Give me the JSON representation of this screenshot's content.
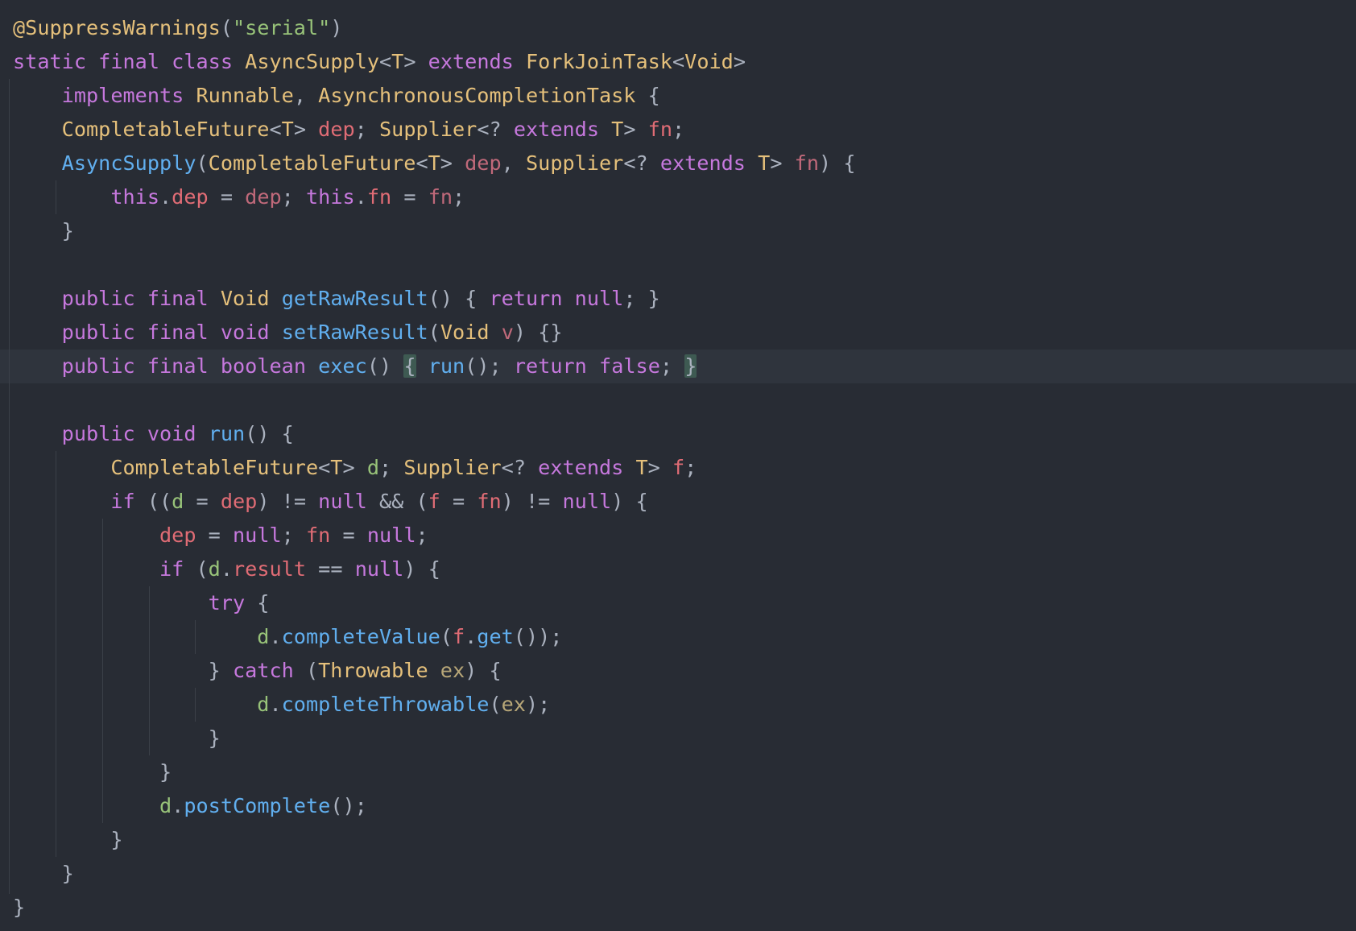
{
  "editor": {
    "theme": {
      "background": "#282c34",
      "current_line": "#2f343d",
      "indent_guide": "#3b4048",
      "brace_match": "#3e5a52",
      "colors": {
        "kw": "#c678dd",
        "type": "#e5c07b",
        "fn": "#61afef",
        "field": "#e06c75",
        "param": "#c0697a",
        "local": "#98c379",
        "catch": "#b8a778",
        "str": "#98c379",
        "ann": "#e5c07b",
        "p": "#abb2bf"
      }
    },
    "current_line_index": 10,
    "lines": [
      {
        "tokens": [
          [
            "ann",
            "@SuppressWarnings"
          ],
          [
            "p",
            "("
          ],
          [
            "str",
            "\"serial\""
          ],
          [
            "p",
            ")"
          ]
        ]
      },
      {
        "tokens": [
          [
            "kw",
            "static"
          ],
          [
            "p",
            " "
          ],
          [
            "kw",
            "final"
          ],
          [
            "p",
            " "
          ],
          [
            "kw",
            "class"
          ],
          [
            "p",
            " "
          ],
          [
            "type",
            "AsyncSupply"
          ],
          [
            "p",
            "<"
          ],
          [
            "type",
            "T"
          ],
          [
            "p",
            "> "
          ],
          [
            "kw",
            "extends"
          ],
          [
            "p",
            " "
          ],
          [
            "type",
            "ForkJoinTask"
          ],
          [
            "p",
            "<"
          ],
          [
            "type",
            "Void"
          ],
          [
            "p",
            ">"
          ]
        ]
      },
      {
        "tokens": [
          [
            "p",
            "    "
          ],
          [
            "kw",
            "implements"
          ],
          [
            "p",
            " "
          ],
          [
            "type",
            "Runnable"
          ],
          [
            "p",
            ", "
          ],
          [
            "type",
            "AsynchronousCompletionTask"
          ],
          [
            "p",
            " {"
          ]
        ]
      },
      {
        "tokens": [
          [
            "p",
            "    "
          ],
          [
            "type",
            "CompletableFuture"
          ],
          [
            "p",
            "<"
          ],
          [
            "type",
            "T"
          ],
          [
            "p",
            "> "
          ],
          [
            "field",
            "dep"
          ],
          [
            "p",
            "; "
          ],
          [
            "type",
            "Supplier"
          ],
          [
            "p",
            "<? "
          ],
          [
            "kw",
            "extends"
          ],
          [
            "p",
            " "
          ],
          [
            "type",
            "T"
          ],
          [
            "p",
            "> "
          ],
          [
            "field",
            "fn"
          ],
          [
            "p",
            ";"
          ]
        ]
      },
      {
        "tokens": [
          [
            "p",
            "    "
          ],
          [
            "fn",
            "AsyncSupply"
          ],
          [
            "p",
            "("
          ],
          [
            "type",
            "CompletableFuture"
          ],
          [
            "p",
            "<"
          ],
          [
            "type",
            "T"
          ],
          [
            "p",
            "> "
          ],
          [
            "param",
            "dep"
          ],
          [
            "p",
            ", "
          ],
          [
            "type",
            "Supplier"
          ],
          [
            "p",
            "<? "
          ],
          [
            "kw",
            "extends"
          ],
          [
            "p",
            " "
          ],
          [
            "type",
            "T"
          ],
          [
            "p",
            "> "
          ],
          [
            "param",
            "fn"
          ],
          [
            "p",
            ") {"
          ]
        ]
      },
      {
        "tokens": [
          [
            "p",
            "        "
          ],
          [
            "kw",
            "this"
          ],
          [
            "p",
            "."
          ],
          [
            "field",
            "dep"
          ],
          [
            "p",
            " = "
          ],
          [
            "param",
            "dep"
          ],
          [
            "p",
            "; "
          ],
          [
            "kw",
            "this"
          ],
          [
            "p",
            "."
          ],
          [
            "field",
            "fn"
          ],
          [
            "p",
            " = "
          ],
          [
            "param",
            "fn"
          ],
          [
            "p",
            ";"
          ]
        ]
      },
      {
        "tokens": [
          [
            "p",
            "    }"
          ]
        ]
      },
      {
        "tokens": []
      },
      {
        "tokens": [
          [
            "p",
            "    "
          ],
          [
            "kw",
            "public"
          ],
          [
            "p",
            " "
          ],
          [
            "kw",
            "final"
          ],
          [
            "p",
            " "
          ],
          [
            "type",
            "Void"
          ],
          [
            "p",
            " "
          ],
          [
            "fn",
            "getRawResult"
          ],
          [
            "p",
            "() { "
          ],
          [
            "kw",
            "return"
          ],
          [
            "p",
            " "
          ],
          [
            "kw",
            "null"
          ],
          [
            "p",
            "; }"
          ]
        ]
      },
      {
        "tokens": [
          [
            "p",
            "    "
          ],
          [
            "kw",
            "public"
          ],
          [
            "p",
            " "
          ],
          [
            "kw",
            "final"
          ],
          [
            "p",
            " "
          ],
          [
            "kw",
            "void"
          ],
          [
            "p",
            " "
          ],
          [
            "fn",
            "setRawResult"
          ],
          [
            "p",
            "("
          ],
          [
            "type",
            "Void"
          ],
          [
            "p",
            " "
          ],
          [
            "param",
            "v"
          ],
          [
            "p",
            ") {}"
          ]
        ]
      },
      {
        "tokens": [
          [
            "p",
            "    "
          ],
          [
            "kw",
            "public"
          ],
          [
            "p",
            " "
          ],
          [
            "kw",
            "final"
          ],
          [
            "p",
            " "
          ],
          [
            "kw",
            "boolean"
          ],
          [
            "p",
            " "
          ],
          [
            "fn",
            "exec"
          ],
          [
            "p",
            "() "
          ],
          [
            "bm",
            "{"
          ],
          [
            "p",
            " "
          ],
          [
            "fn",
            "run"
          ],
          [
            "p",
            "(); "
          ],
          [
            "kw",
            "return"
          ],
          [
            "p",
            " "
          ],
          [
            "kw",
            "false"
          ],
          [
            "p",
            "; "
          ],
          [
            "bm",
            "}"
          ]
        ]
      },
      {
        "tokens": []
      },
      {
        "tokens": [
          [
            "p",
            "    "
          ],
          [
            "kw",
            "public"
          ],
          [
            "p",
            " "
          ],
          [
            "kw",
            "void"
          ],
          [
            "p",
            " "
          ],
          [
            "fn",
            "run"
          ],
          [
            "p",
            "() {"
          ]
        ]
      },
      {
        "tokens": [
          [
            "p",
            "        "
          ],
          [
            "type",
            "CompletableFuture"
          ],
          [
            "p",
            "<"
          ],
          [
            "type",
            "T"
          ],
          [
            "p",
            "> "
          ],
          [
            "local",
            "d"
          ],
          [
            "p",
            "; "
          ],
          [
            "type",
            "Supplier"
          ],
          [
            "p",
            "<? "
          ],
          [
            "kw",
            "extends"
          ],
          [
            "p",
            " "
          ],
          [
            "type",
            "T"
          ],
          [
            "p",
            "> "
          ],
          [
            "field",
            "f"
          ],
          [
            "p",
            ";"
          ]
        ]
      },
      {
        "tokens": [
          [
            "p",
            "        "
          ],
          [
            "kw",
            "if"
          ],
          [
            "p",
            " (("
          ],
          [
            "local",
            "d"
          ],
          [
            "p",
            " = "
          ],
          [
            "field",
            "dep"
          ],
          [
            "p",
            ") != "
          ],
          [
            "kw",
            "null"
          ],
          [
            "p",
            " && ("
          ],
          [
            "field",
            "f"
          ],
          [
            "p",
            " = "
          ],
          [
            "field",
            "fn"
          ],
          [
            "p",
            ") != "
          ],
          [
            "kw",
            "null"
          ],
          [
            "p",
            ") {"
          ]
        ]
      },
      {
        "tokens": [
          [
            "p",
            "            "
          ],
          [
            "field",
            "dep"
          ],
          [
            "p",
            " = "
          ],
          [
            "kw",
            "null"
          ],
          [
            "p",
            "; "
          ],
          [
            "field",
            "fn"
          ],
          [
            "p",
            " = "
          ],
          [
            "kw",
            "null"
          ],
          [
            "p",
            ";"
          ]
        ]
      },
      {
        "tokens": [
          [
            "p",
            "            "
          ],
          [
            "kw",
            "if"
          ],
          [
            "p",
            " ("
          ],
          [
            "local",
            "d"
          ],
          [
            "p",
            "."
          ],
          [
            "field",
            "result"
          ],
          [
            "p",
            " == "
          ],
          [
            "kw",
            "null"
          ],
          [
            "p",
            ") {"
          ]
        ]
      },
      {
        "tokens": [
          [
            "p",
            "                "
          ],
          [
            "kw",
            "try"
          ],
          [
            "p",
            " {"
          ]
        ]
      },
      {
        "tokens": [
          [
            "p",
            "                    "
          ],
          [
            "local",
            "d"
          ],
          [
            "p",
            "."
          ],
          [
            "fn",
            "completeValue"
          ],
          [
            "p",
            "("
          ],
          [
            "field",
            "f"
          ],
          [
            "p",
            "."
          ],
          [
            "fn",
            "get"
          ],
          [
            "p",
            "());"
          ]
        ]
      },
      {
        "tokens": [
          [
            "p",
            "                } "
          ],
          [
            "kw",
            "catch"
          ],
          [
            "p",
            " ("
          ],
          [
            "type",
            "Throwable"
          ],
          [
            "p",
            " "
          ],
          [
            "catch",
            "ex"
          ],
          [
            "p",
            ") {"
          ]
        ]
      },
      {
        "tokens": [
          [
            "p",
            "                    "
          ],
          [
            "local",
            "d"
          ],
          [
            "p",
            "."
          ],
          [
            "fn",
            "completeThrowable"
          ],
          [
            "p",
            "("
          ],
          [
            "catch",
            "ex"
          ],
          [
            "p",
            ");"
          ]
        ]
      },
      {
        "tokens": [
          [
            "p",
            "                }"
          ]
        ]
      },
      {
        "tokens": [
          [
            "p",
            "            }"
          ]
        ]
      },
      {
        "tokens": [
          [
            "p",
            "            "
          ],
          [
            "local",
            "d"
          ],
          [
            "p",
            "."
          ],
          [
            "fn",
            "postComplete"
          ],
          [
            "p",
            "();"
          ]
        ]
      },
      {
        "tokens": [
          [
            "p",
            "        }"
          ]
        ]
      },
      {
        "tokens": [
          [
            "p",
            "    }"
          ]
        ]
      },
      {
        "tokens": [
          [
            "p",
            "}"
          ]
        ]
      }
    ]
  }
}
